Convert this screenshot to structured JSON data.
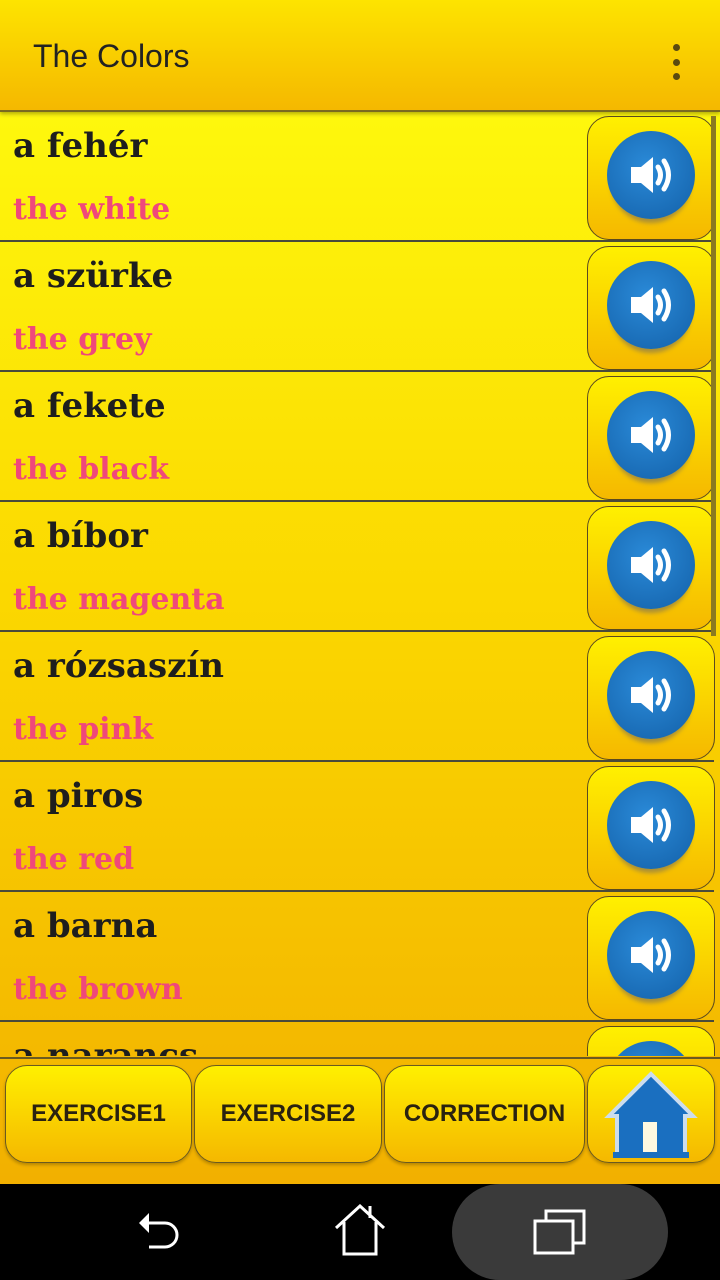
{
  "app_bar": {
    "title": "The Colors",
    "menu_icon": "more-vert-icon"
  },
  "words": [
    {
      "hungarian": "a fehér",
      "english": "the white"
    },
    {
      "hungarian": "a szürke",
      "english": "the grey"
    },
    {
      "hungarian": "a fekete",
      "english": "the black"
    },
    {
      "hungarian": "a bíbor",
      "english": "the magenta"
    },
    {
      "hungarian": "a rózsaszín",
      "english": "the pink"
    },
    {
      "hungarian": "a piros",
      "english": "the red"
    },
    {
      "hungarian": "a barna",
      "english": "the brown"
    },
    {
      "hungarian": "a narancs",
      "english": ""
    }
  ],
  "bottom_bar": {
    "exercise1": "EXERCISE1",
    "exercise2": "EXERCISE2",
    "correction": "CORRECTION",
    "home_icon": "home-icon"
  },
  "colors": {
    "english_text": "#f0487a",
    "speaker": "#1a6fc0"
  }
}
